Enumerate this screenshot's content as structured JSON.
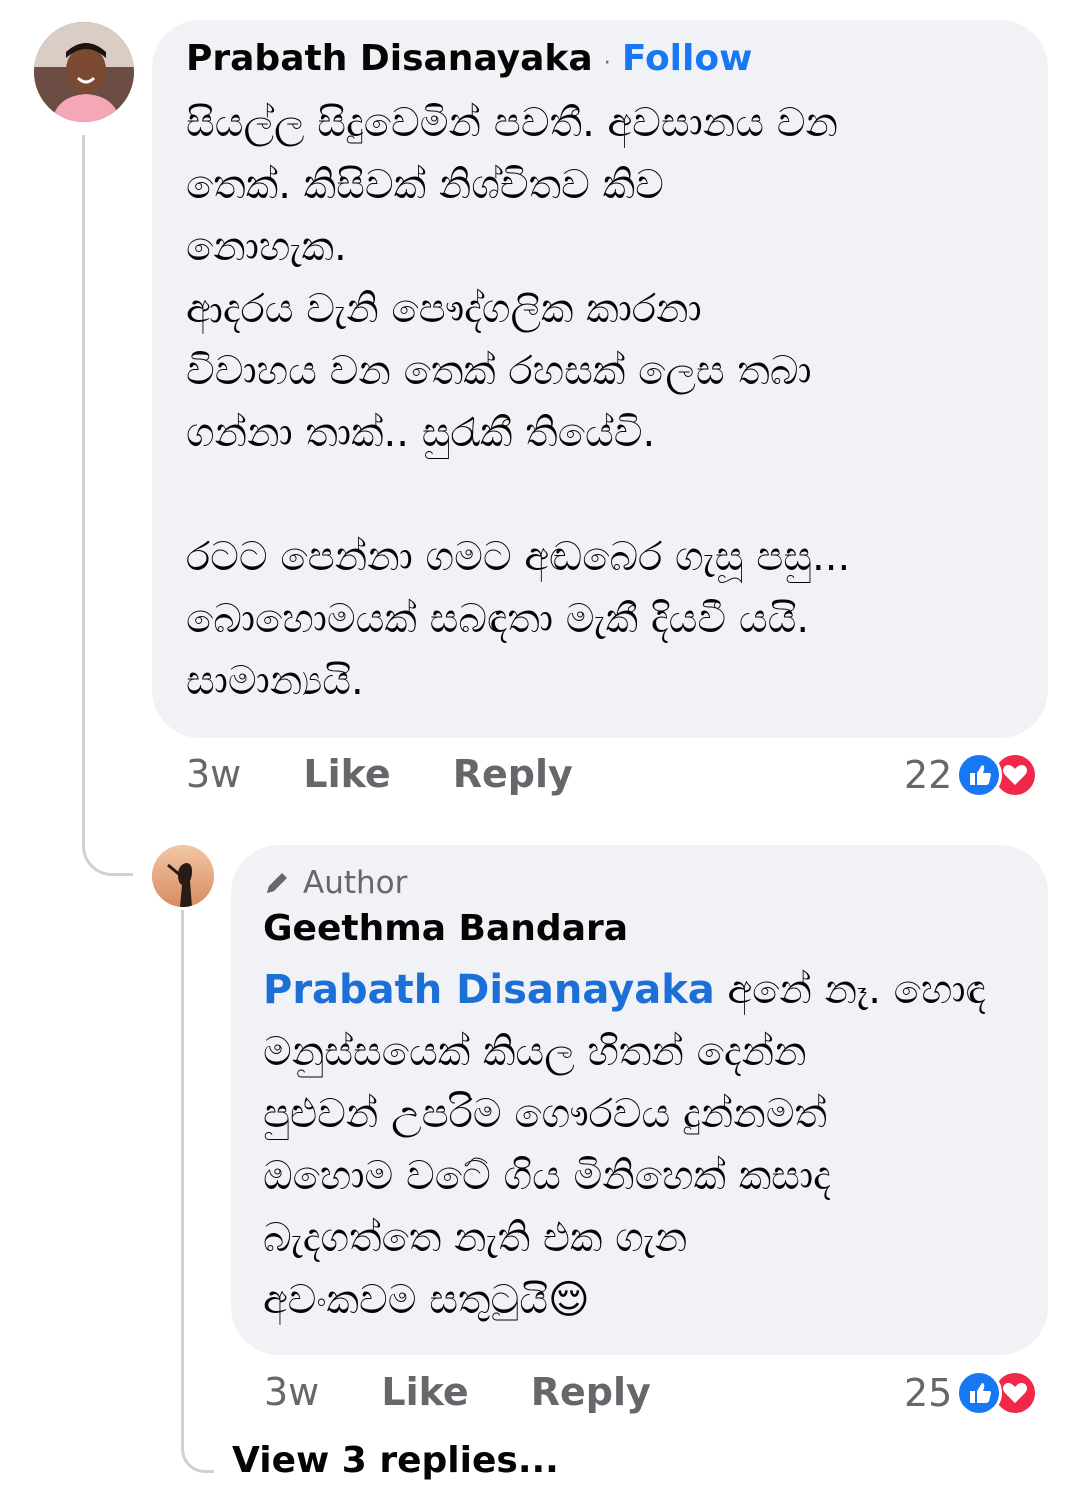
{
  "comment1": {
    "author": "Prabath Disanayaka",
    "follow": "Follow",
    "separator": "·",
    "lines": [
      "සියල්ල සිදුවෙමින් පවතී. අවසානය වන",
      "තෙක්. කිසිවක් නිශ්චිතව කිව",
      "නොහැක.",
      "ආදරය වැනි පෞද්ගලික කාරනා",
      "විවාහය වන තෙක් රහසක් ලෙස තබා",
      "ගන්නා තාක්.. සුරැකී තියේවි.",
      "",
      "රටට පෙන්නා ගමට අඬබෙර ගැසූ පසු...",
      "බොහොමයක් සබඳතා මැකී දියවී යයි.",
      "සාමාන්‍යයි."
    ],
    "time": "3w",
    "like": "Like",
    "reply": "Reply",
    "reaction_count": "22",
    "reaction_icons": [
      "like-icon",
      "love-icon"
    ]
  },
  "comment2": {
    "badge_icon": "pencil-icon",
    "badge": "Author",
    "author": "Geethma Bandara",
    "mention": "Prabath Disanayaka",
    "line1_rest": " අනේ නෑ. හොඳ",
    "lines": [
      "මනුස්සයෙක් කියල හිතන් දෙන්න",
      "පුළුවන් උපරිම ගෞරවය දුන්නමත්",
      "ඔහොම වටේ ගිය මිනිහෙක් කසාද",
      "බැදගත්තෙ නැති එක ගැන"
    ],
    "last_line": "අවංකවම සතුටුයි",
    "emoji": "😌",
    "time": "3w",
    "like": "Like",
    "reply": "Reply",
    "reaction_count": "25",
    "reaction_icons": [
      "like-icon",
      "love-icon"
    ]
  },
  "view_replies": "View 3 replies...",
  "colors": {
    "bubble": "#f0f2f5",
    "link_blue": "#1877f2",
    "meta_gray": "#65676b",
    "like_blue": "#1877f2",
    "love_red": "#f0284a"
  }
}
